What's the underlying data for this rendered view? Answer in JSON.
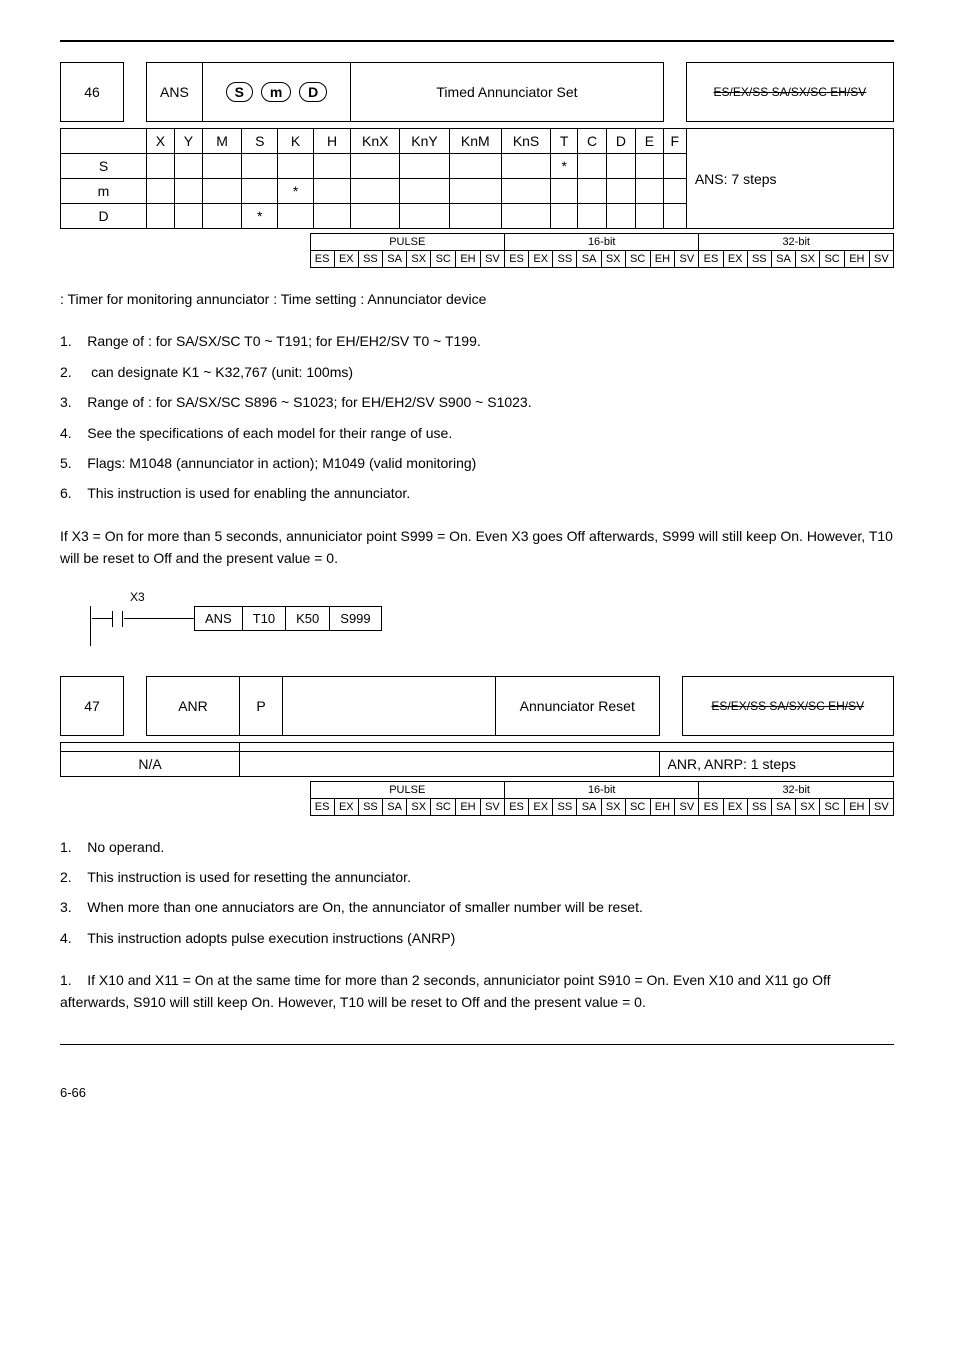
{
  "inst1": {
    "api": "46",
    "mnemonic": "ANS",
    "ops": [
      "S",
      "m",
      "D"
    ],
    "function": "Timed Annunciator Set",
    "compat": "ES/EX/SS SA/SX/SC EH/SV",
    "typeHeaders": [
      "X",
      "Y",
      "M",
      "S",
      "K",
      "H",
      "KnX",
      "KnY",
      "KnM",
      "KnS",
      "T",
      "C",
      "D",
      "E",
      "F"
    ],
    "rows": [
      {
        "n": "S",
        "c": [
          0,
          0,
          0,
          0,
          0,
          0,
          0,
          0,
          0,
          0,
          1,
          0,
          0,
          0,
          0
        ]
      },
      {
        "n": "m",
        "c": [
          0,
          0,
          0,
          0,
          1,
          0,
          0,
          0,
          0,
          0,
          0,
          0,
          0,
          0,
          0
        ]
      },
      {
        "n": "D",
        "c": [
          0,
          0,
          0,
          1,
          0,
          0,
          0,
          0,
          0,
          0,
          0,
          0,
          0,
          0,
          0
        ]
      }
    ],
    "steps": "ANS: 7 steps",
    "pulse": [
      "ES",
      "EX",
      "SS",
      "SA",
      "SX",
      "SC",
      "EH",
      "SV"
    ],
    "b16": [
      "ES",
      "EX",
      "SS",
      "SA",
      "SX",
      "SC",
      "EH",
      "SV"
    ],
    "b32": [
      "ES",
      "EX",
      "SS",
      "SA",
      "SX",
      "SC",
      "EH",
      "SV"
    ],
    "pulseLabel": "PULSE",
    "b16Label": "16-bit",
    "b32Label": "32-bit"
  },
  "ops1": {
    "line": " : Timer for monitoring annunciator        : Time setting       : Annunciator device"
  },
  "expl1": [
    "Range of   : for SA/SX/SC T0 ~ T191; for EH/EH2/SV T0 ~ T199.",
    "    can designate K1 ~ K32,767 (unit: 100ms)",
    "Range of   : for SA/SX/SC S896 ~ S1023; for EH/EH2/SV S900 ~ S1023.",
    "See the specifications of each model for their range of use.",
    "Flags: M1048 (annunciator in action); M1049 (valid monitoring)",
    "This instruction is used for enabling the annunciator."
  ],
  "prog1": {
    "text1": "If X3 = On for more than 5 seconds, annuniciator point S999 = On. Even X3 goes Off afterwards, S999 will still keep On. However, T10 will be reset to Off and the present value = 0.",
    "contact": "X3",
    "boxes": [
      "ANS",
      "T10",
      "K50",
      "S999"
    ]
  },
  "inst2": {
    "api": "47",
    "mnemonic": "ANR",
    "p": "P",
    "function": "Annunciator Reset",
    "compat": "ES/EX/SS SA/SX/SC EH/SV",
    "na": "N/A",
    "steps": "ANR, ANRP: 1 steps",
    "pulse": [
      "ES",
      "EX",
      "SS",
      "SA",
      "SX",
      "SC",
      "EH",
      "SV"
    ],
    "b16": [
      "ES",
      "EX",
      "SS",
      "SA",
      "SX",
      "SC",
      "EH",
      "SV"
    ],
    "b32": [
      "ES",
      "EX",
      "SS",
      "SA",
      "SX",
      "SC",
      "EH",
      "SV"
    ],
    "pulseLabel": "PULSE",
    "b16Label": "16-bit",
    "b32Label": "32-bit"
  },
  "expl2": [
    "No operand.",
    "This instruction is used for resetting the annunciator.",
    "When more than one annuciators are On, the annunciator of smaller number will be reset.",
    "This instruction adopts pulse execution instructions (ANRP)"
  ],
  "prog2": [
    "If X10 and X11 = On at the same time for more than 2 seconds, annuniciator point S910 = On. Even X10 and X11 go Off afterwards, S910 will still keep On. However, T10 will be reset to Off and the present value = 0."
  ],
  "pageNum": "6-66"
}
